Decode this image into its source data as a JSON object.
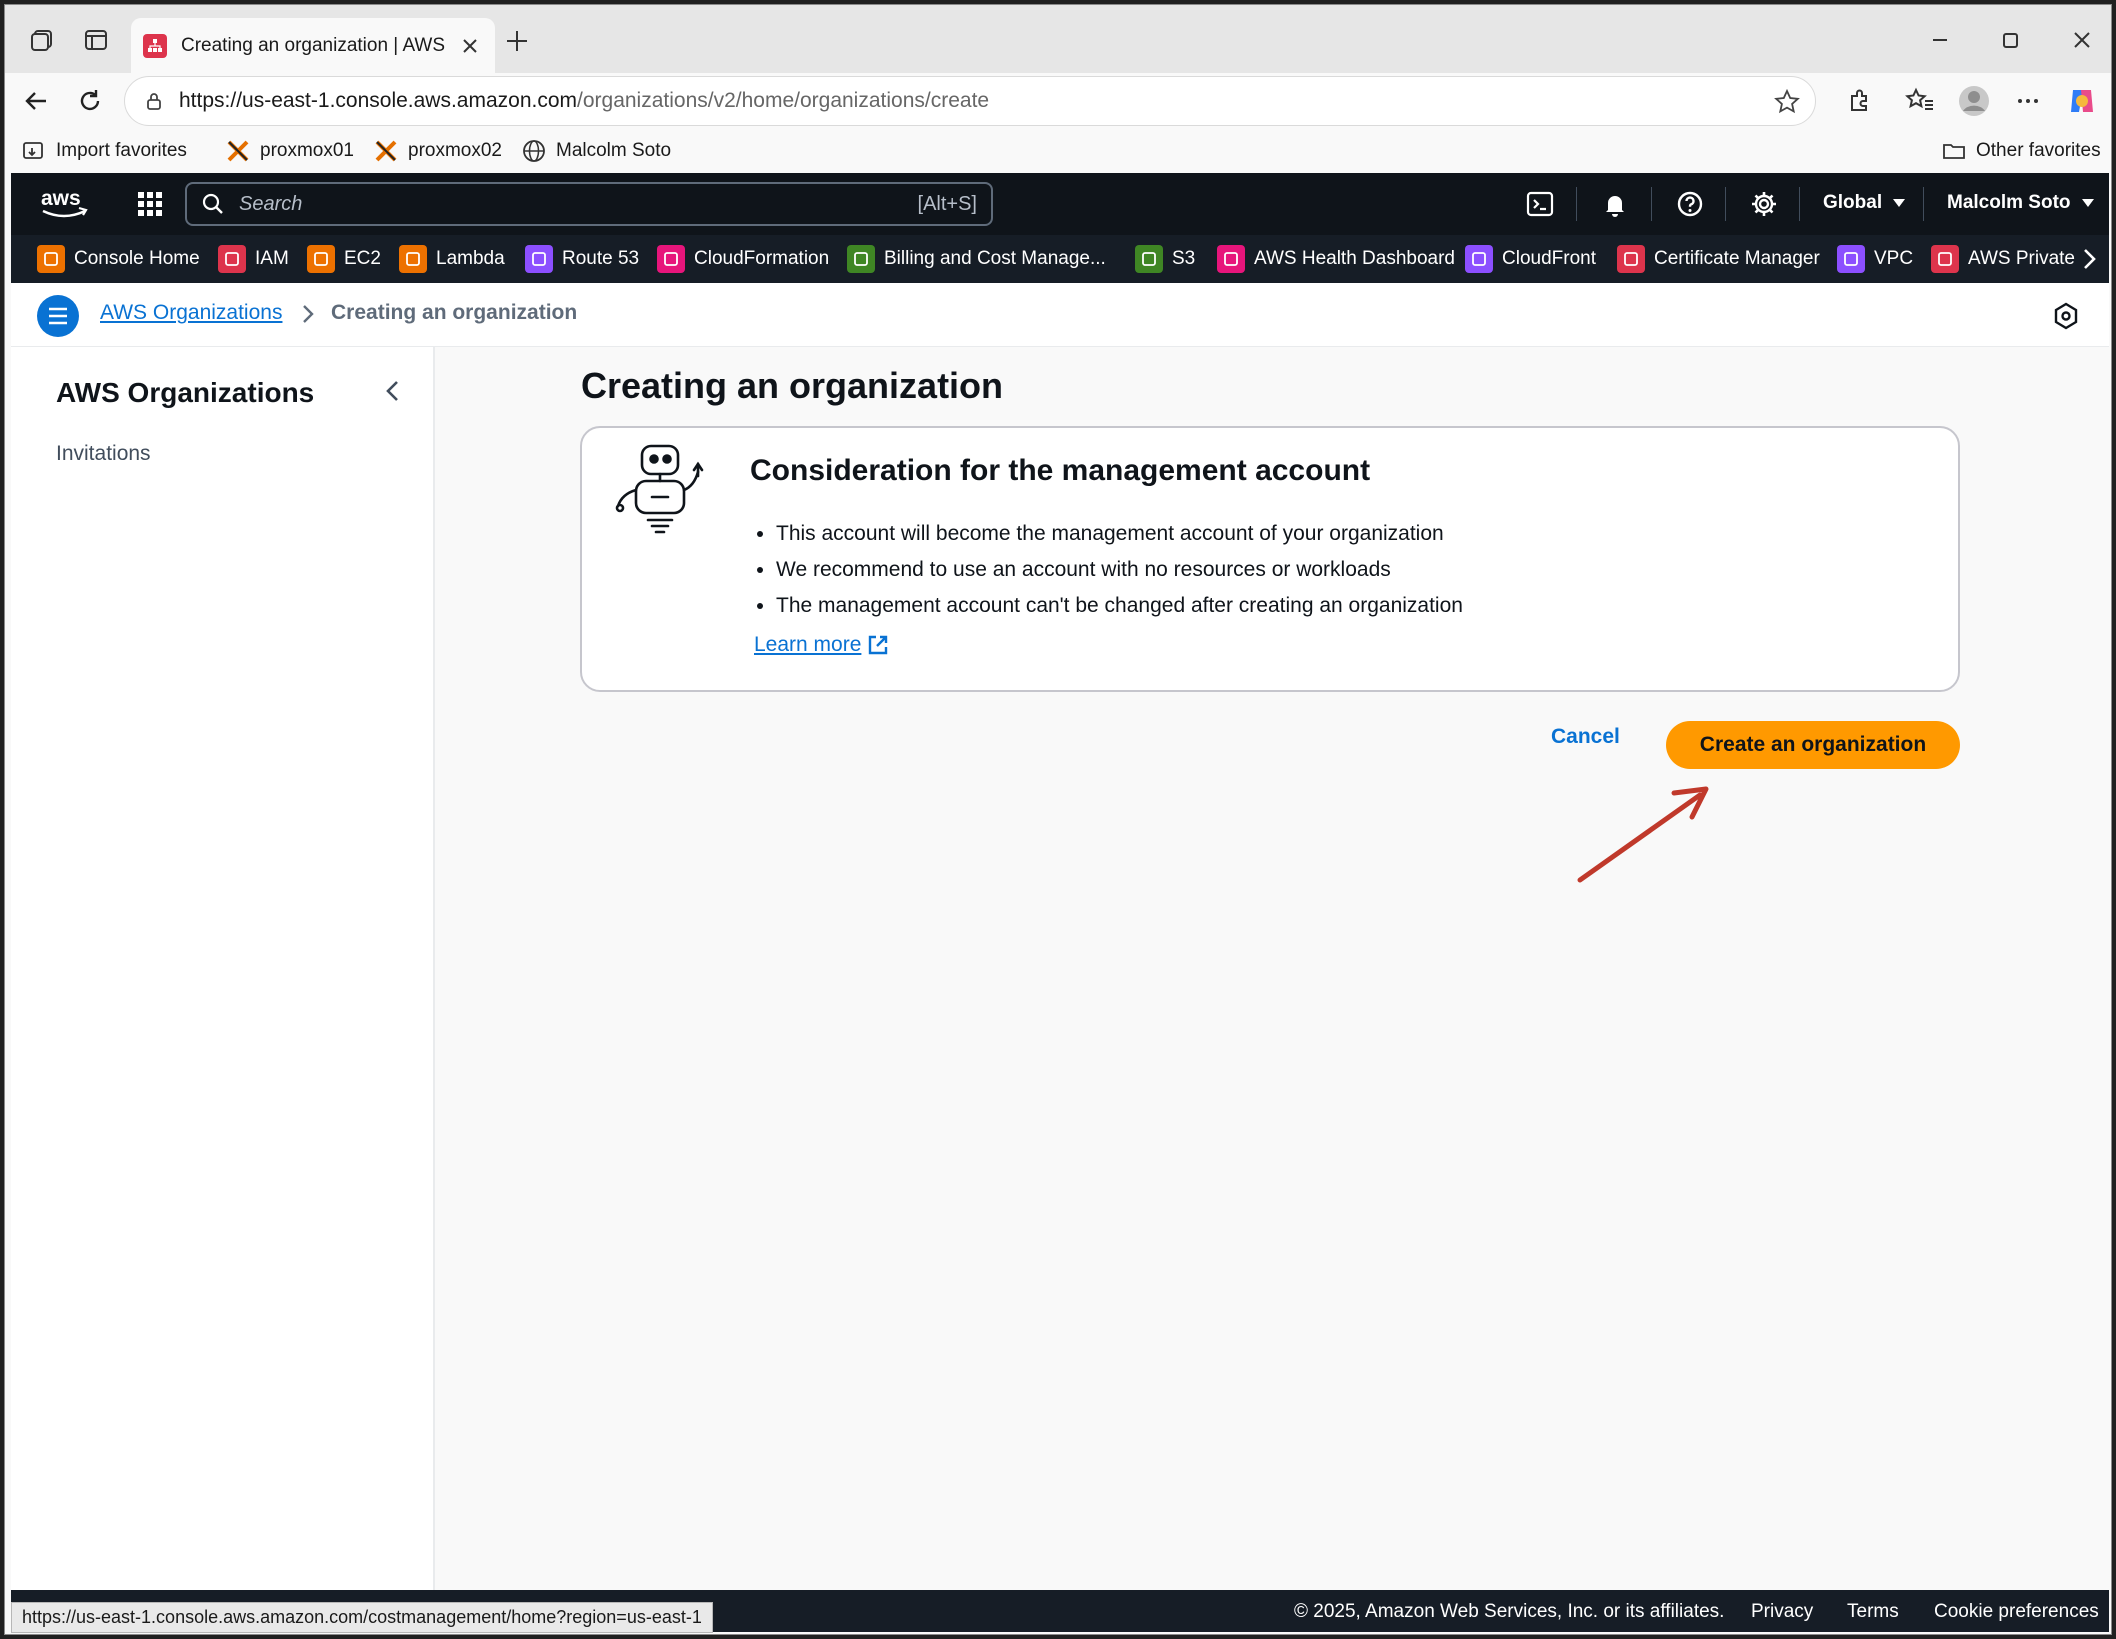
{
  "browser": {
    "tab_title": "Creating an organization | AWS O",
    "url_host": "https://us-east-1.console.aws.amazon.com",
    "url_path": "/organizations/v2/home/organizations/create",
    "bookmarks": [
      "Import favorites",
      "proxmox01",
      "proxmox02",
      "Malcolm Soto"
    ],
    "other_favorites": "Other favorites",
    "status_url": "https://us-east-1.console.aws.amazon.com/costmanagement/home?region=us-east-1"
  },
  "aws_nav": {
    "search_placeholder": "Search",
    "search_shortcut": "[Alt+S]",
    "region": "Global",
    "user": "Malcolm Soto"
  },
  "services": [
    {
      "label": "Console Home",
      "color": "#ed7100"
    },
    {
      "label": "IAM",
      "color": "#dd344c"
    },
    {
      "label": "EC2",
      "color": "#ed7100"
    },
    {
      "label": "Lambda",
      "color": "#ed7100"
    },
    {
      "label": "Route 53",
      "color": "#8c4fff"
    },
    {
      "label": "CloudFormation",
      "color": "#e7157b"
    },
    {
      "label": "Billing and Cost Manage...",
      "color": "#3f8624"
    },
    {
      "label": "S3",
      "color": "#3f8624"
    },
    {
      "label": "AWS Health Dashboard",
      "color": "#e7157b"
    },
    {
      "label": "CloudFront",
      "color": "#8c4fff"
    },
    {
      "label": "Certificate Manager",
      "color": "#dd344c"
    },
    {
      "label": "VPC",
      "color": "#8c4fff"
    },
    {
      "label": "AWS Private",
      "color": "#dd344c"
    }
  ],
  "breadcrumb": {
    "root": "AWS Organizations",
    "current": "Creating an organization"
  },
  "sidebar": {
    "title": "AWS Organizations",
    "items": [
      "Invitations"
    ]
  },
  "main": {
    "title": "Creating an organization",
    "card": {
      "heading": "Consideration for the management account",
      "bullets": [
        "This account will become the management account of your organization",
        "We recommend to use an account with no resources or workloads",
        "The management account can't be changed after creating an organization"
      ],
      "learn_more": "Learn more"
    },
    "cancel_label": "Cancel",
    "create_label": "Create an organization"
  },
  "footer": {
    "copyright": "© 2025, Amazon Web Services, Inc. or its affiliates.",
    "links": [
      "Privacy",
      "Terms",
      "Cookie preferences"
    ]
  },
  "colors": {
    "accent_blue": "#0972d3",
    "primary_button": "#ff9900",
    "nav_bg": "#0f141a",
    "annotation_arrow": "#c0392b"
  }
}
